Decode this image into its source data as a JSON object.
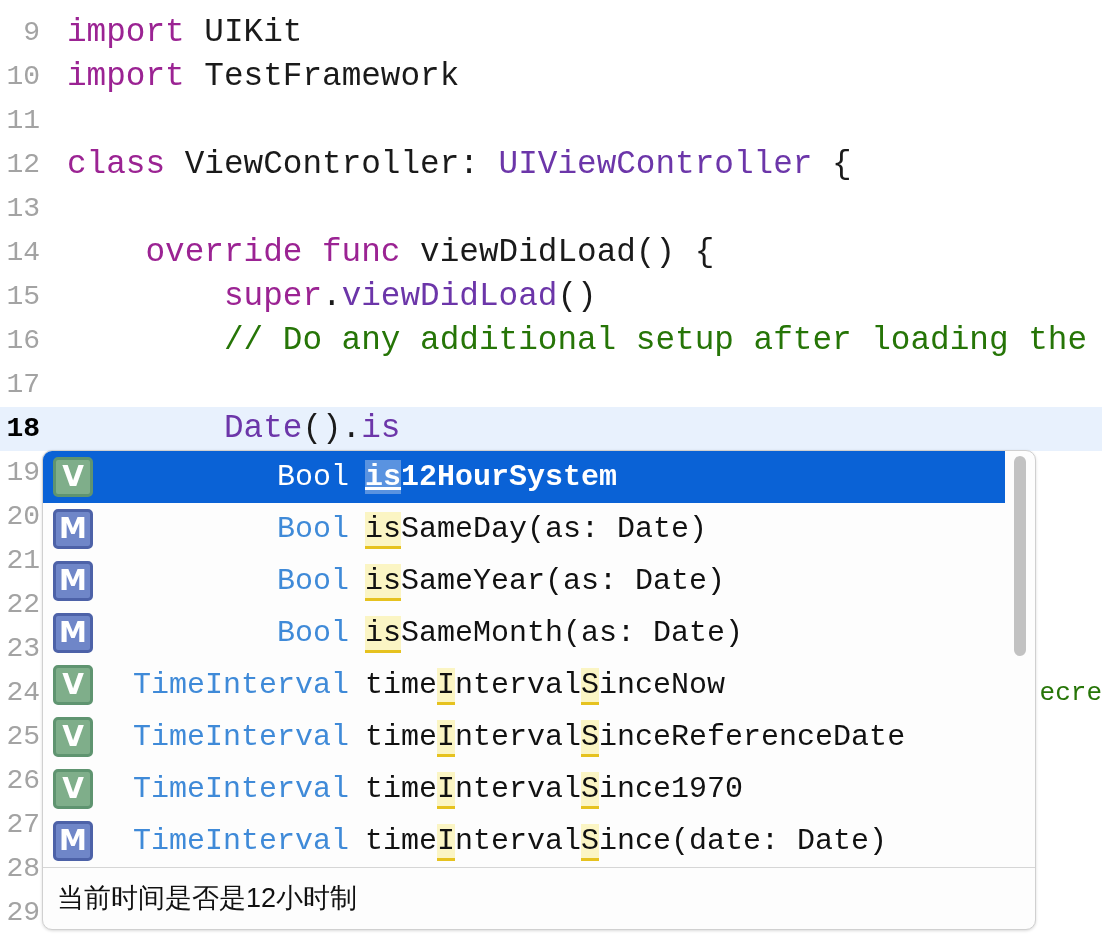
{
  "editor": {
    "lines": [
      {
        "number": "9",
        "current": false,
        "tokens": [
          {
            "kind": "keyword",
            "text": "import"
          },
          {
            "kind": "plain",
            "text": " UIKit"
          }
        ]
      },
      {
        "number": "10",
        "current": false,
        "tokens": [
          {
            "kind": "keyword",
            "text": "import"
          },
          {
            "kind": "plain",
            "text": " TestFramework"
          }
        ]
      },
      {
        "number": "11",
        "current": false
      },
      {
        "number": "12",
        "current": false,
        "tokens": [
          {
            "kind": "keyword",
            "text": "class"
          },
          {
            "kind": "plain",
            "text": " ViewController: "
          },
          {
            "kind": "type",
            "text": "UIViewController"
          },
          {
            "kind": "plain",
            "text": " {"
          }
        ]
      },
      {
        "number": "13",
        "current": false
      },
      {
        "number": "14",
        "current": false,
        "tokens": [
          {
            "kind": "keyword",
            "text": "    override"
          },
          {
            "kind": "keyword",
            "text": " func"
          },
          {
            "kind": "plain",
            "text": " viewDidLoad() {"
          }
        ]
      },
      {
        "number": "15",
        "current": false,
        "tokens": [
          {
            "kind": "keyword",
            "text": "        super"
          },
          {
            "kind": "plain",
            "text": "."
          },
          {
            "kind": "type",
            "text": "viewDidLoad"
          },
          {
            "kind": "plain",
            "text": "()"
          }
        ]
      },
      {
        "number": "16",
        "current": false,
        "tokens": [
          {
            "kind": "comment",
            "text": "        // Do any additional setup after loading the"
          }
        ]
      },
      {
        "number": "17",
        "current": false
      },
      {
        "number": "18",
        "current": true,
        "tokens": [
          {
            "kind": "type",
            "text": "        Date"
          },
          {
            "kind": "plain",
            "text": "()."
          },
          {
            "kind": "type",
            "text": "is"
          }
        ]
      },
      {
        "number": "19",
        "current": false
      },
      {
        "number": "20",
        "current": false
      },
      {
        "number": "21",
        "current": false
      },
      {
        "number": "22",
        "current": false
      },
      {
        "number": "23",
        "current": false
      },
      {
        "number": "24",
        "current": false,
        "trailing": "ecre"
      },
      {
        "number": "25",
        "current": false
      },
      {
        "number": "26",
        "current": false
      },
      {
        "number": "27",
        "current": false
      },
      {
        "number": "28",
        "current": false
      },
      {
        "number": "29",
        "current": false
      }
    ]
  },
  "completion": {
    "items": [
      {
        "kind": "variable",
        "badge": "V",
        "type": "Bool",
        "selected": true,
        "name": [
          {
            "text": "is",
            "match": true
          },
          {
            "text": "12HourSystem",
            "match": false
          }
        ]
      },
      {
        "kind": "method",
        "badge": "M",
        "type": "Bool",
        "selected": false,
        "name": [
          {
            "text": "is",
            "match": true
          },
          {
            "text": "SameDay(as: Date)",
            "match": false
          }
        ]
      },
      {
        "kind": "method",
        "badge": "M",
        "type": "Bool",
        "selected": false,
        "name": [
          {
            "text": "is",
            "match": true
          },
          {
            "text": "SameYear(as: Date)",
            "match": false
          }
        ]
      },
      {
        "kind": "method",
        "badge": "M",
        "type": "Bool",
        "selected": false,
        "name": [
          {
            "text": "is",
            "match": true
          },
          {
            "text": "SameMonth(as: Date)",
            "match": false
          }
        ]
      },
      {
        "kind": "variable",
        "badge": "V",
        "type": "TimeInterval",
        "selected": false,
        "name": [
          {
            "text": "time",
            "match": false
          },
          {
            "text": "I",
            "match": true
          },
          {
            "text": "nterval",
            "match": false
          },
          {
            "text": "S",
            "match": true
          },
          {
            "text": "inceNow",
            "match": false
          }
        ]
      },
      {
        "kind": "variable",
        "badge": "V",
        "type": "TimeInterval",
        "selected": false,
        "name": [
          {
            "text": "time",
            "match": false
          },
          {
            "text": "I",
            "match": true
          },
          {
            "text": "nterval",
            "match": false
          },
          {
            "text": "S",
            "match": true
          },
          {
            "text": "inceReferenceDate",
            "match": false
          }
        ]
      },
      {
        "kind": "variable",
        "badge": "V",
        "type": "TimeInterval",
        "selected": false,
        "name": [
          {
            "text": "time",
            "match": false
          },
          {
            "text": "I",
            "match": true
          },
          {
            "text": "nterval",
            "match": false
          },
          {
            "text": "S",
            "match": true
          },
          {
            "text": "ince1970",
            "match": false
          }
        ]
      },
      {
        "kind": "method",
        "badge": "M",
        "type": "TimeInterval",
        "selected": false,
        "name": [
          {
            "text": "time",
            "match": false
          },
          {
            "text": "I",
            "match": true
          },
          {
            "text": "nterval",
            "match": false
          },
          {
            "text": "S",
            "match": true
          },
          {
            "text": "ince(date: Date)",
            "match": false
          }
        ]
      }
    ],
    "description": "当前时间是否是12小时制"
  }
}
